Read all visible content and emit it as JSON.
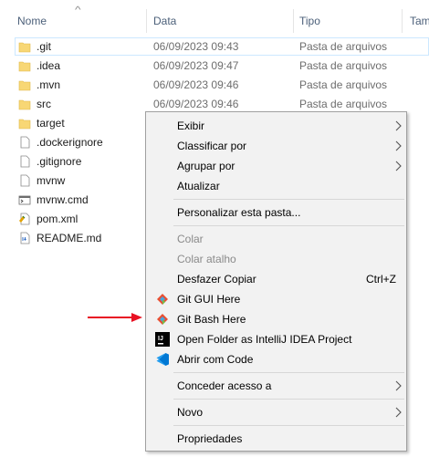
{
  "columns": {
    "name": "Nome",
    "date": "Data",
    "type": "Tipo",
    "size": "Tam"
  },
  "files": [
    {
      "name": ".git",
      "date": "06/09/2023 09:43",
      "type": "Pasta de arquivos",
      "icon": "folder-icon"
    },
    {
      "name": ".idea",
      "date": "06/09/2023 09:47",
      "type": "Pasta de arquivos",
      "icon": "folder-icon"
    },
    {
      "name": ".mvn",
      "date": "06/09/2023 09:46",
      "type": "Pasta de arquivos",
      "icon": "folder-icon"
    },
    {
      "name": "src",
      "date": "06/09/2023 09:46",
      "type": "Pasta de arquivos",
      "icon": "folder-icon"
    },
    {
      "name": "target",
      "date": "",
      "type": "",
      "icon": "folder-icon"
    },
    {
      "name": ".dockerignore",
      "date": "",
      "type": "",
      "icon": "file-icon"
    },
    {
      "name": ".gitignore",
      "date": "",
      "type": "",
      "icon": "file-icon"
    },
    {
      "name": "mvnw",
      "date": "",
      "type": "",
      "icon": "file-icon"
    },
    {
      "name": "mvnw.cmd",
      "date": "",
      "type": "",
      "icon": "cmd-file-icon"
    },
    {
      "name": "pom.xml",
      "date": "",
      "type": "",
      "icon": "xml-file-icon"
    },
    {
      "name": "README.md",
      "date": "",
      "type": "",
      "icon": "md-file-icon"
    }
  ],
  "context_menu": {
    "view": "Exibir",
    "sort_by": "Classificar por",
    "group_by": "Agrupar por",
    "refresh": "Atualizar",
    "customize": "Personalizar esta pasta...",
    "paste": "Colar",
    "paste_shortcut": "Colar atalho",
    "undo_copy": "Desfazer Copiar",
    "undo_copy_shortcut": "Ctrl+Z",
    "git_gui": "Git GUI Here",
    "git_bash": "Git Bash Here",
    "open_intellij": "Open Folder as IntelliJ IDEA Project",
    "open_code": "Abrir com Code",
    "give_access": "Conceder acesso a",
    "new": "Novo",
    "properties": "Propriedades",
    "intellij_icon_text": "IJ"
  },
  "colors": {
    "folder": "#f8d775",
    "arrow": "#e81123",
    "vscode": "#0078d4"
  }
}
